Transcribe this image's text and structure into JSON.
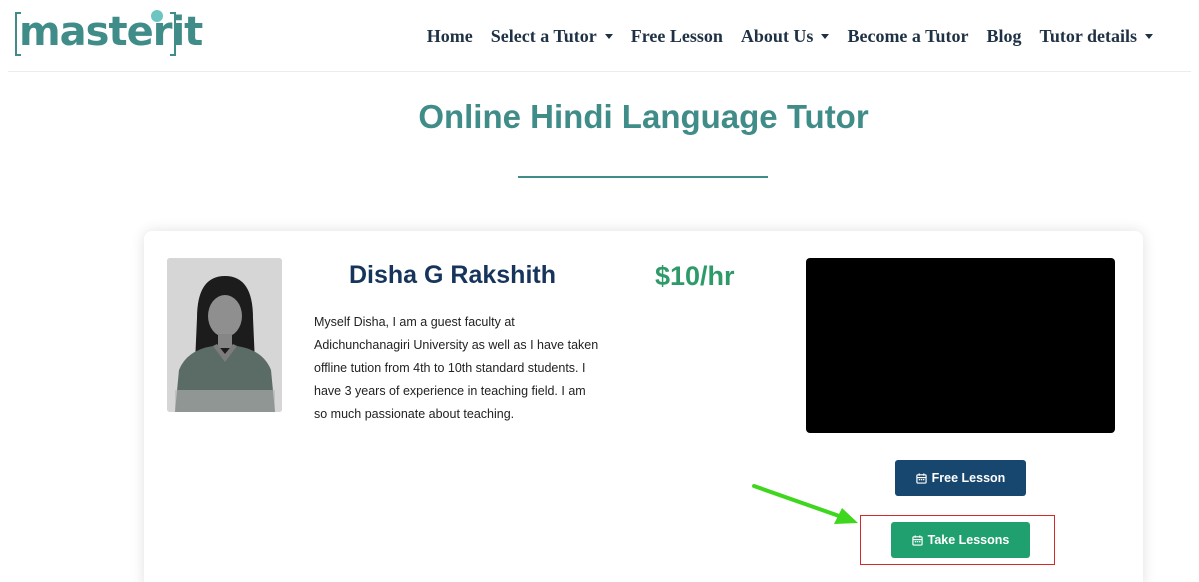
{
  "logo": {
    "text": "masterit"
  },
  "nav": {
    "items": [
      {
        "label": "Home",
        "has_caret": false
      },
      {
        "label": "Select a Tutor",
        "has_caret": true
      },
      {
        "label": "Free Lesson",
        "has_caret": false
      },
      {
        "label": "About Us",
        "has_caret": true
      },
      {
        "label": "Become a Tutor",
        "has_caret": false
      },
      {
        "label": "Blog",
        "has_caret": false
      },
      {
        "label": "Tutor details",
        "has_caret": true
      }
    ]
  },
  "page": {
    "title": "Online Hindi Language Tutor"
  },
  "tutor": {
    "name": "Disha G Rakshith",
    "price": "$10/hr",
    "bio": "Myself Disha, I am a guest faculty at Adichunchanagiri University as well as I have taken offline tution from 4th to 10th standard students. I have 3 years of experience in teaching field. I am so much passionate about teaching."
  },
  "buttons": {
    "free_lesson": "Free Lesson",
    "take_lessons": "Take Lessons",
    "icon": "calendar-icon"
  },
  "colors": {
    "brand_teal": "#3f8c88",
    "name_navy": "#17355c",
    "price_green": "#2e9a6a",
    "free_button": "#17466e",
    "take_button": "#21a06f",
    "annotation_box": "#d22a2a",
    "annotation_arrow": "#3fd61e"
  }
}
